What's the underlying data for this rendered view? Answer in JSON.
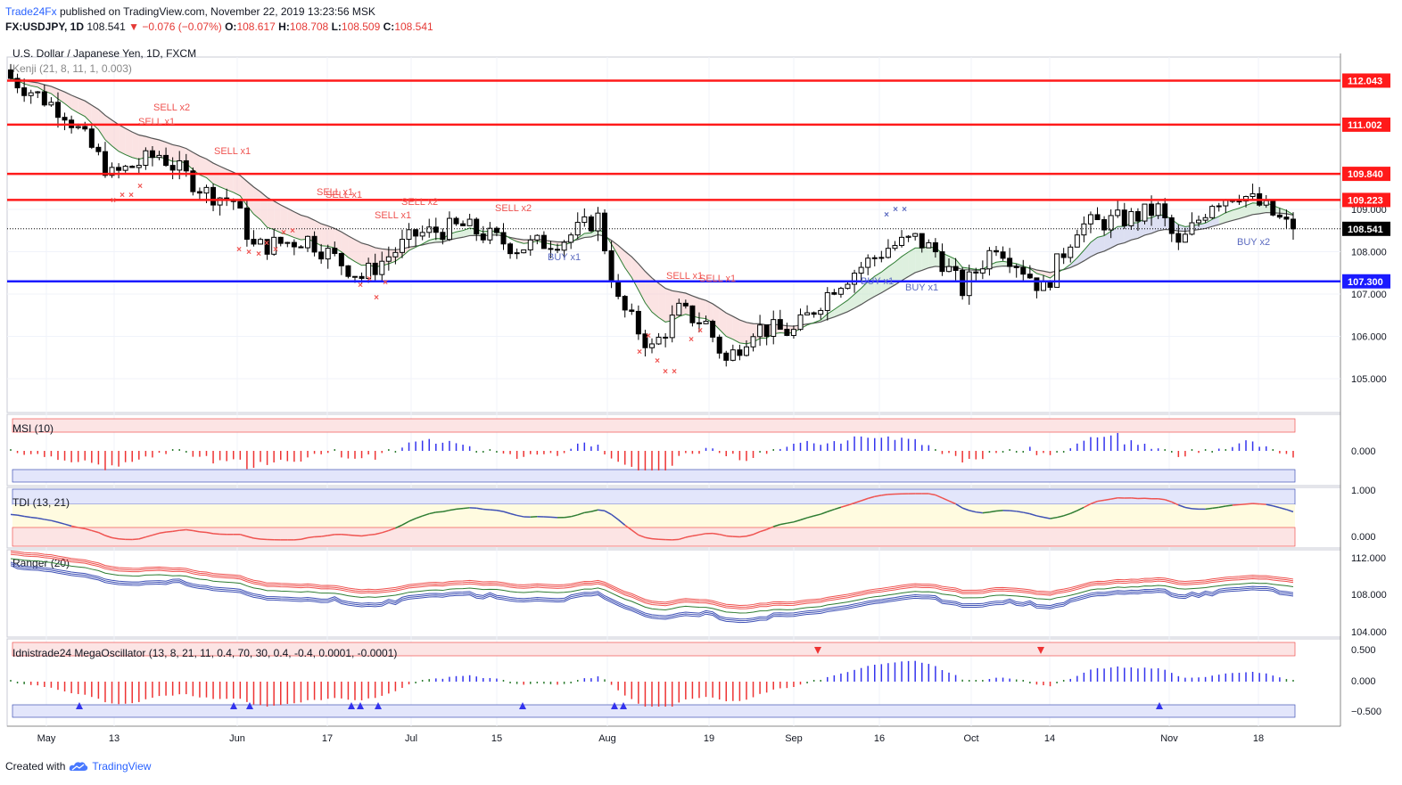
{
  "header": {
    "publisher": "Trade24Fx",
    "published_text": "published on TradingView.com, November 22, 2019 13:23:56 MSK",
    "symbol": "FX:USDJPY, 1D",
    "last": "108.541",
    "change": "−0.076 (−0.07%)",
    "o_label": "O:",
    "o_val": "108.617",
    "h_label": "H:",
    "h_val": "108.708",
    "l_label": "L:",
    "l_val": "108.509",
    "c_label": "C:",
    "c_val": "108.541"
  },
  "footer": {
    "created_with": "Created with",
    "brand": "TradingView"
  },
  "chart_data": [
    {
      "type": "candlestick",
      "title": "U.S. Dollar / Japanese Yen, 1D, FXCM",
      "indicator": "Kenji (21, 8, 11, 1, 0.003)",
      "x_ticks": [
        "May",
        "13",
        "Jun",
        "17",
        "Jul",
        "15",
        "Aug",
        "19",
        "Sep",
        "16",
        "Oct",
        "14",
        "Nov",
        "18"
      ],
      "y_ticks": [
        "109.000",
        "108.000",
        "107.000",
        "106.000",
        "105.000"
      ],
      "ylim": [
        104.2,
        112.6
      ],
      "last_price": "108.541",
      "horizontal_levels": [
        {
          "price": "112.043",
          "color": "#ff1a1a"
        },
        {
          "price": "111.002",
          "color": "#ff1a1a"
        },
        {
          "price": "109.840",
          "color": "#ff1a1a"
        },
        {
          "price": "109.223",
          "color": "#ff1a1a"
        },
        {
          "price": "107.300",
          "color": "#1a1aff"
        }
      ],
      "signals": [
        {
          "text": "SELL x2",
          "color": "#ef5350"
        },
        {
          "text": "SELL x1",
          "color": "#ef5350"
        },
        {
          "text": "SELL x1",
          "color": "#ef5350"
        },
        {
          "text": "SELL x1",
          "color": "#ef5350"
        },
        {
          "text": "SELL x1",
          "color": "#ef5350"
        },
        {
          "text": "SELL x1",
          "color": "#ef5350"
        },
        {
          "text": "SELL x2",
          "color": "#ef5350"
        },
        {
          "text": "SELL x2",
          "color": "#ef5350"
        },
        {
          "text": "BUY x1",
          "color": "#5c6bc0"
        },
        {
          "text": "SELL x1",
          "color": "#ef5350"
        },
        {
          "text": "SELL x1",
          "color": "#ef5350"
        },
        {
          "text": "BUY x1",
          "color": "#5c6bc0"
        },
        {
          "text": "BUY x1",
          "color": "#5c6bc0"
        },
        {
          "text": "BUY x2",
          "color": "#5c6bc0"
        }
      ]
    },
    {
      "type": "bar",
      "title": "MSI (10)",
      "y_ticks": [
        "0.000"
      ]
    },
    {
      "type": "line",
      "title": "TDI (13, 21)",
      "y_ticks": [
        "1.000",
        "0.000"
      ]
    },
    {
      "type": "line",
      "title": "Ranger (20)",
      "y_ticks": [
        "112.000",
        "108.000",
        "104.000"
      ]
    },
    {
      "type": "bar",
      "title": "Idnistrade24 MegaOscillator (13, 8, 21, 11, 0.4, 70, 30, 0.4, -0.4, 0.0001, -0.0001)",
      "y_ticks": [
        "0.500",
        "0.000",
        "−0.500"
      ]
    }
  ],
  "colors": {
    "bull": "#ffffff",
    "bear": "#000000",
    "resistance": "#ff1a1a",
    "support": "#1a1aff",
    "sell": "#ef5350",
    "buy": "#5c6bc0",
    "grid": "#f0f3fa"
  },
  "icons": {
    "footer_logo": "tradingview-cloud-icon",
    "change_arrow": "down-triangle-icon"
  }
}
